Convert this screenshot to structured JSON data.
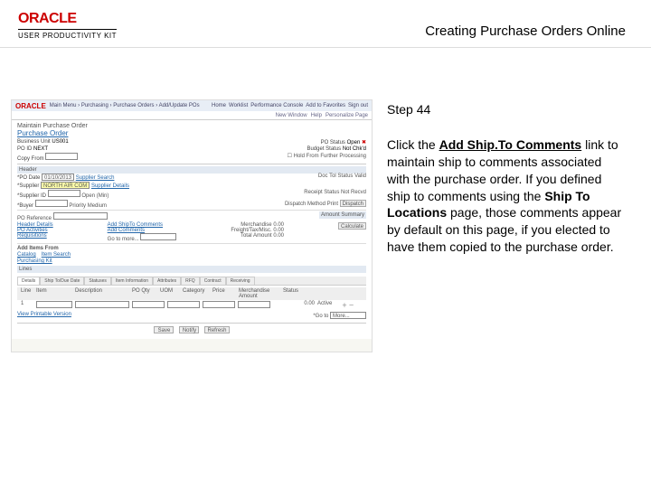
{
  "brand": {
    "name": "ORACLE",
    "product": "USER PRODUCTIVITY KIT"
  },
  "doc_title": "Creating Purchase Orders Online",
  "step_label": "Step 44",
  "instruction": {
    "pre1": "Click the ",
    "bold1": "Add Ship.To Comments",
    "mid1": " link to maintain ship to comments associated with the purchase order. If you defined ship to comments using the ",
    "bold2": "Ship To Locations",
    "mid2": " page, those comments appear by default on this page, if you elected to have them copied to the purchase order."
  },
  "screenshot": {
    "brand": "ORACLE",
    "breadcrumbs": [
      "Main Menu",
      "Purchasing",
      "Purchase Orders",
      "Add/Update POs"
    ],
    "navtabs": [
      "Home",
      "Worklist",
      "Performance Console",
      "Add to Favorites",
      "Sign out"
    ],
    "subbar": [
      "New Window",
      "Help",
      "Personalize Page"
    ],
    "page_title": "Maintain Purchase Order",
    "section_title": "Purchase Order",
    "fields": {
      "business_unit": "US001",
      "po_id": "NEXT",
      "copy_from": "",
      "po_status": "Open",
      "budget_status": "Not Chk'd",
      "hold_checkbox": "Hold From Further Processing"
    },
    "header_section": "Header",
    "header_fields": {
      "po_date_label": "*PO Date",
      "po_date": "01/10/2013",
      "supplier_search": "Supplier Search",
      "doc_tol_status": "Doc Tol Status Valid",
      "supplier_label": "*Supplier",
      "supplier": "NORTH AIR COM",
      "supplier_details": "Supplier Details",
      "supplier_id_label": "*Supplier ID",
      "supplier_id": "",
      "receipt_status": "Receipt Status Not Recvd",
      "buyer_label": "*Buyer",
      "buyer": "",
      "dispatch_method": "Dispatch Method Print",
      "dispatch_btn": "Dispatch"
    },
    "po_reference": "PO Reference",
    "header_details": "Header Details",
    "po_activities": "PO Activities",
    "requisitions": "Requisitions",
    "priority_label": "Priority",
    "priority": "Medium",
    "add_shipto": "Add ShipTo Comments",
    "add_comments": "Add Comments",
    "actions_label": "Go to more...",
    "amount_summary": "Amount Summary",
    "merchandise": "Merchandise",
    "freight_tax": "Freight/Tax/Misc.",
    "total_amount": "Total Amount",
    "amt_zero": "0.00",
    "calculate": "Calculate",
    "add_items_from": "Add Items From",
    "catalog": "Catalog",
    "purchasing_kit": "Purchasing Kit",
    "item_search": "Item Search",
    "lines": "Lines",
    "tabs": [
      "Details",
      "Ship To/Due Date",
      "Statuses",
      "Item Information",
      "Attributes",
      "RFQ",
      "Contract",
      "Receiving"
    ],
    "line_cols": [
      "Line",
      "Item",
      "Description",
      "PO Qty",
      "UOM",
      "Category",
      "Price",
      "Merchandise Amount",
      "Status"
    ],
    "line1_status": "Active",
    "view_printable": "View Printable Version",
    "go_to": "*Go to",
    "more": "More...",
    "notify": "Notify",
    "refresh": "Refresh"
  }
}
